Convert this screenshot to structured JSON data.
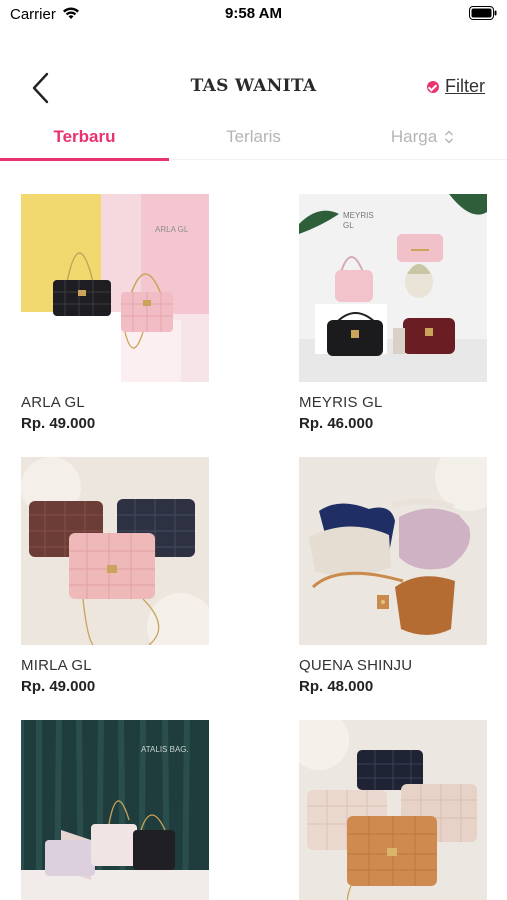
{
  "status_bar": {
    "carrier": "Carrier",
    "time": "9:58 AM"
  },
  "nav": {
    "title": "TAS WANITA",
    "filter_label": "Filter"
  },
  "tabs": [
    {
      "label": "Terbaru",
      "active": true
    },
    {
      "label": "Terlaris",
      "active": false
    },
    {
      "label": "Harga",
      "active": false
    }
  ],
  "products": [
    {
      "name": "ARLA GL",
      "price": "Rp. 49.000",
      "photo_text": [
        "ARLA GL"
      ]
    },
    {
      "name": "MEYRIS GL",
      "price": "Rp. 46.000",
      "photo_text": [
        "MEYRIS",
        "GL"
      ]
    },
    {
      "name": "MIRLA GL",
      "price": "Rp. 49.000"
    },
    {
      "name": "QUENA SHINJU",
      "price": "Rp. 48.000"
    },
    {
      "name": "",
      "price": "",
      "photo_text": [
        "ATALIS BAG."
      ]
    },
    {
      "name": "",
      "price": ""
    }
  ],
  "colors": {
    "accent": "#e8336f"
  }
}
